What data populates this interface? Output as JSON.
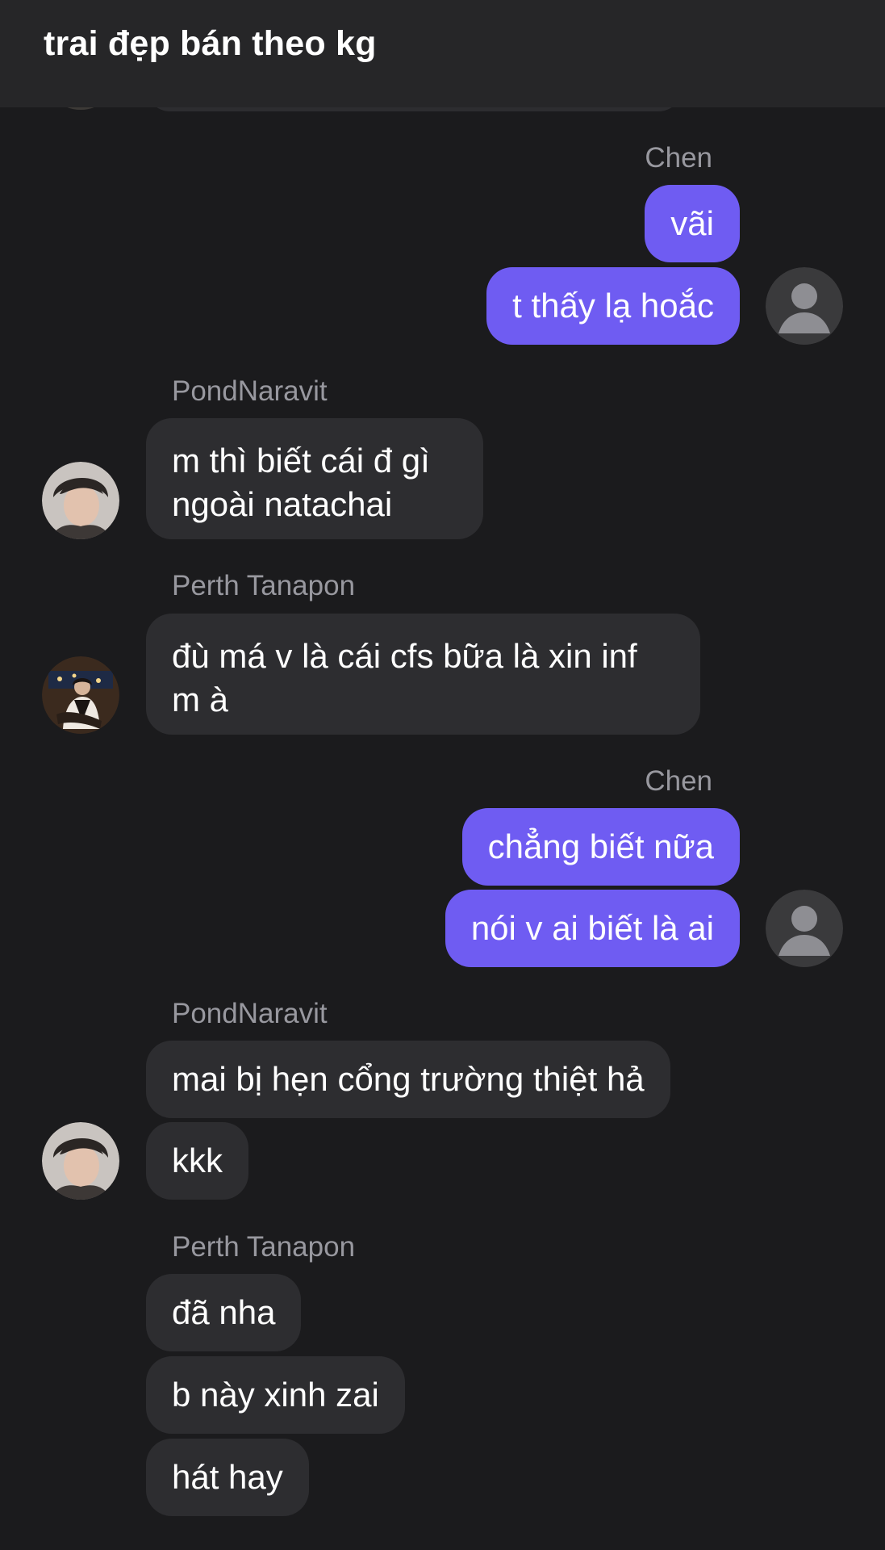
{
  "header": {
    "title": "trai đẹp bán theo kg"
  },
  "messages": [
    {
      "sender": "Chen",
      "bubbles": [
        "vãi",
        "t thấy lạ hoắc"
      ]
    },
    {
      "sender": "PondNaravit",
      "bubbles": [
        "m thì biết cái đ gì ngoài natachai"
      ]
    },
    {
      "sender": "Perth Tanapon",
      "bubbles": [
        "đù má v là cái cfs bữa là xin inf m à"
      ]
    },
    {
      "sender": "Chen",
      "bubbles": [
        "chẳng biết nữa",
        "nói v ai biết là ai"
      ]
    },
    {
      "sender": "PondNaravit",
      "bubbles": [
        "mai bị hẹn cổng trường thiệt hả",
        "kkk"
      ]
    },
    {
      "sender": "Perth Tanapon",
      "bubbles": [
        "đã nha",
        "b này xinh zai",
        "hát hay"
      ]
    }
  ],
  "colors": {
    "background": "#1b1b1d",
    "header": "#262628",
    "outgoing_bubble": "#6f5cf2",
    "incoming_bubble": "#2d2d30",
    "sender_name": "#98989f"
  }
}
